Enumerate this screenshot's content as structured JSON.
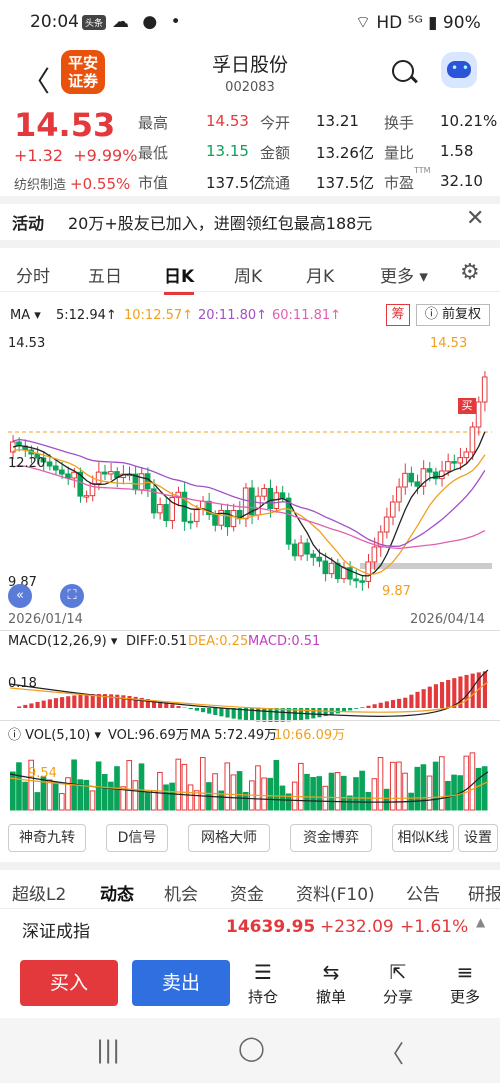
{
  "status_bar": {
    "time": "20:04",
    "badge": "头条",
    "icons": "☁ ● •",
    "right": "⌔ HD ⁵ᴳ ▮ 90%"
  },
  "header": {
    "logo": "平安\n证券",
    "title": "孚日股份",
    "code": "002083"
  },
  "quote": {
    "price": "14.53",
    "change": "+1.32",
    "change_pct": "+9.99%",
    "sector": "纺织制造",
    "sector_pct": "+0.55%",
    "fields": [
      {
        "label": "最高",
        "value": "14.53",
        "color": "red"
      },
      {
        "label": "今开",
        "value": "13.21",
        "color": ""
      },
      {
        "label": "换手",
        "value": "10.21%",
        "color": ""
      },
      {
        "label": "最低",
        "value": "13.15",
        "color": "green"
      },
      {
        "label": "金额",
        "value": "13.26亿",
        "color": ""
      },
      {
        "label": "量比",
        "value": "1.58",
        "color": ""
      },
      {
        "label": "市值",
        "value": "137.5亿",
        "color": ""
      },
      {
        "label": "流通",
        "value": "137.5亿",
        "color": ""
      },
      {
        "label": "市盈",
        "value": "32.10",
        "color": "",
        "sup": "TTM"
      }
    ]
  },
  "notice": {
    "tag": "活动",
    "message": "20万+股友已加入，进圈领红包最高188元",
    "close": "✕"
  },
  "tabs": [
    "分时",
    "五日",
    "日K",
    "周K",
    "月K",
    "更多 ▾"
  ],
  "active_tab": "日K",
  "chart": {
    "ma_label": "MA ▾",
    "ma5": "5:12.94↑",
    "ma10": "10:12.57↑",
    "ma20": "20:11.80↑",
    "ma60": "60:11.81↑",
    "chip_btn": "筹",
    "adjust_btn": "ⓘ 前复权",
    "y_high": "14.53",
    "y_mid": "12.20",
    "y_low": "9.87",
    "hi_label": "14.53",
    "lo_label": "9.87",
    "buy_tag": "买",
    "date_start": "2026/01/14",
    "date_end": "2026/04/14",
    "macd_title": "MACD(12,26,9) ▾",
    "diff": "DIFF:0.51",
    "dea": "DEA:0.25",
    "macd": "MACD:0.51",
    "macd_y": "0.18",
    "vol_title": "ⓘ VOL(5,10) ▾",
    "vol": "VOL:96.69万",
    "vol_ma5": "MA 5:72.49万",
    "vol_ma10": "10:66.09万",
    "vol_y": "9.54",
    "colors": {
      "up": "#e4393c",
      "down": "#0aa35a",
      "ma5": "#222222",
      "ma10": "#f0a020",
      "ma20": "#a050c8",
      "ma60": "#e060b0"
    }
  },
  "tools": [
    "神奇九转",
    "D信号",
    "网格大师",
    "资金博弈",
    "相似K线",
    "设置"
  ],
  "subtabs": [
    "超级L2",
    "动态",
    "机会",
    "资金",
    "资料(F10)",
    "公告",
    "研报"
  ],
  "index": {
    "name": "深证成指",
    "value": "14639.95",
    "change": "+232.09",
    "pct": "+1.61%",
    "arrow": "▲"
  },
  "actions": {
    "buy": "买入",
    "sell": "卖出",
    "items": [
      {
        "icon": "☰",
        "label": "持仓"
      },
      {
        "icon": "⇆",
        "label": "撤单"
      },
      {
        "icon": "⇱",
        "label": "分享"
      },
      {
        "icon": "≡",
        "label": "更多"
      }
    ]
  },
  "nav": [
    "|||",
    "◯",
    "〈"
  ]
}
